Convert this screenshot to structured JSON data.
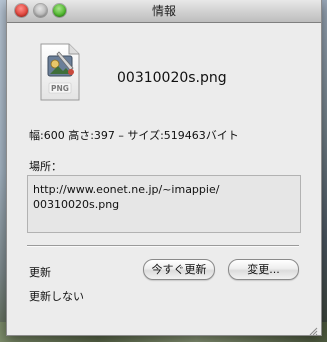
{
  "window": {
    "title": "情報"
  },
  "file": {
    "icon": "png-file-icon",
    "icon_label": "PNG",
    "name": "00310020s.png"
  },
  "info": {
    "dimensions_line": "幅:600 高さ:397 – サイズ:519463バイト"
  },
  "location": {
    "label": "場所：",
    "url": "http://www.eonet.ne.jp/~imappie/\n00310020s.png"
  },
  "update": {
    "label": "更新",
    "update_now_button": "今すぐ更新",
    "change_button": "変更...",
    "option_text": "更新しない"
  },
  "colors": {
    "close": "#e0443a",
    "minimize": "#b8b8b8",
    "maximize": "#4fb82e"
  }
}
